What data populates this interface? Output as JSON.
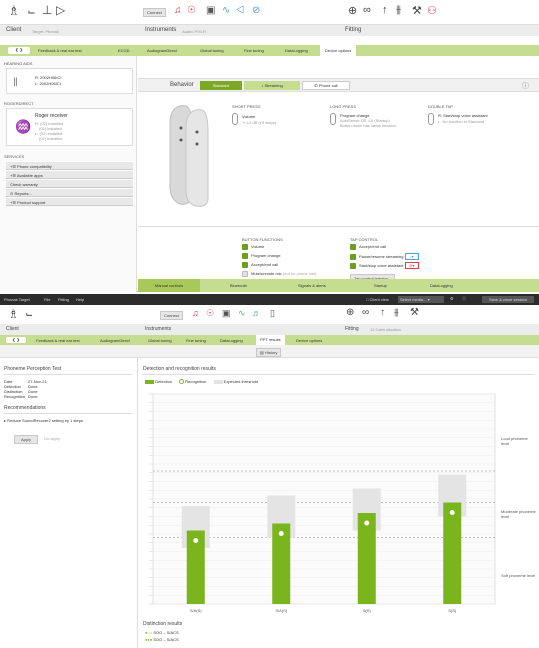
{
  "top": {
    "connect": "Connect",
    "client_label": "Client",
    "client_target": "Target: Phonak",
    "instruments_label": "Instruments",
    "instruments_sub": "Audéo P90-R",
    "fitting_label": "Fitting",
    "tabs_row1": [
      "Feedback & real ear test",
      "ECGD"
    ],
    "tabs_row2": [
      "AudiogramDirect",
      "Global tuning",
      "Fine tuning",
      "DataLogging",
      "Device options"
    ],
    "sidebar": {
      "hearing_aids_title": "HEARING AIDS",
      "ha_right": "R: 2002H06ICI",
      "ha_left": "L: 2002H06ICI",
      "roger_title": "ROGERDIRECT",
      "roger_name": "Roger receiver",
      "roger_lines": [
        "R: (02) installed",
        "(02) installed",
        "L: (02) installed",
        "(02) installed"
      ],
      "services_title": "SERVICES",
      "services": [
        "Phone compatibility",
        "Available apps",
        "Check warranty",
        "Reports...",
        "Product support"
      ]
    },
    "behavior": "Behavior",
    "behavior_tabs": [
      "Standard",
      "Streaming",
      "Phone call"
    ],
    "short_press": "SHORT PRESS",
    "short_value": "Volume",
    "short_sub": "+/-10 dB (±5 steps)",
    "long_press": "LONG PRESS",
    "long_value": "Program change",
    "long_sub1": "AutoSense OS 4.0 (Startup)",
    "long_sub2": "Button down has same function",
    "double_tap": "DOUBLE TAP",
    "dt_r": "R: Start/stop voice assistant",
    "dt_l": "L: No function in Standard",
    "button_functions_title": "BUTTON FUNCTIONS",
    "button_functions": [
      "Volume",
      "Program change",
      "Accept/end call",
      "Mute/unmute mic"
    ],
    "mute_note": "(not for phone call)",
    "tap_control_title": "TAP CONTROL",
    "tap_control": [
      "Accept/end call",
      "Pause/resume streaming",
      "Start/stop voice assistant"
    ],
    "tap_training": "Tap control training...",
    "bottom_tabs": [
      "Manual controls",
      "Bluetooth",
      "Signals & alerts",
      "Startup",
      "DataLogging"
    ]
  },
  "bottom": {
    "menu": [
      "Phonak Target",
      "File",
      "Fitting",
      "Help"
    ],
    "menu_right": [
      "Client view",
      "Select media...",
      "Save & close session"
    ],
    "connect": "Connect",
    "client_label": "Client",
    "instruments_label": "Instruments",
    "fitting_label": "Fitting",
    "fitting_sub": "12 Calm situation",
    "tabs": [
      "Feedback & real ear test",
      "AudiogramDirect",
      "Global tuning",
      "Fine tuning",
      "DataLogging",
      "PPT results",
      "Device options"
    ],
    "history": "History",
    "left_title": "Phoneme Perception Test",
    "info_rows": [
      [
        "Date",
        "27-Nov-21"
      ],
      [
        "Detection",
        "Done"
      ],
      [
        "Distinction",
        "Done"
      ],
      [
        "Recognition",
        "Done"
      ]
    ],
    "recommendations_title": "Recommendations",
    "recommendation": "Reduce SoundRecover2 setting by 1 steps",
    "apply": "Apply",
    "undo": "Un-apply",
    "chart_title": "Detection and recognition results",
    "legend": [
      "Detection",
      "Recognition",
      "Expected threshold"
    ],
    "right_labels": [
      "Loud phoneme level",
      "Moderate phoneme level",
      "Soft phoneme level"
    ],
    "distinction_title": "Distinction results",
    "distinction_rows": [
      "SOO – S/ACS",
      "SOO – S/ACS"
    ]
  },
  "chart_data": {
    "type": "bar",
    "title": "Detection and recognition results",
    "categories": [
      "S/A(S)",
      "S/A(S)",
      "S(S)",
      "S(S)"
    ],
    "series": [
      {
        "name": "Detection",
        "values": [
          21,
          23,
          26,
          29
        ]
      },
      {
        "name": "Expected threshold",
        "values": [
          28,
          31,
          33,
          37
        ]
      }
    ],
    "ylim": [
      0,
      60
    ],
    "grid": true,
    "legend_position": "top-left"
  },
  "colors": {
    "green_dark": "#7da826",
    "green_bar": "#7ab51d",
    "green_light": "#c5dd91",
    "red_icon": "#e03a4b",
    "blue_icon": "#4f9fd8",
    "dark_menu": "#2c2c2c"
  }
}
